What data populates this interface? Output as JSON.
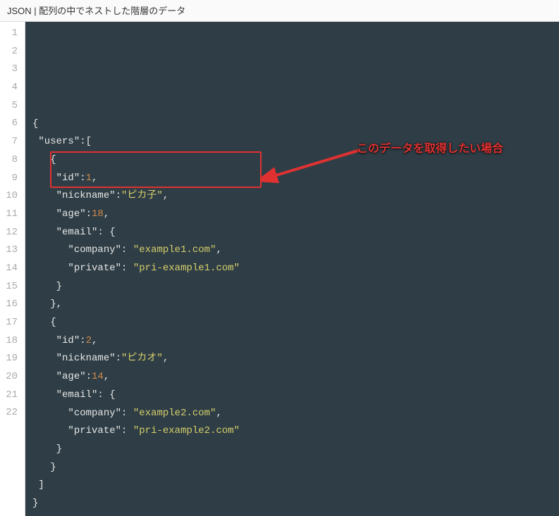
{
  "header": {
    "title": "JSON | 配列の中でネストした階層のデータ"
  },
  "annotation": {
    "text": "このデータを取得したい場合"
  },
  "code": {
    "lines": [
      [
        {
          "t": "{",
          "c": "punc"
        }
      ],
      [
        {
          "t": " ",
          "c": "punc"
        },
        {
          "t": "\"users\"",
          "c": "key"
        },
        {
          "t": ":[",
          "c": "punc"
        }
      ],
      [
        {
          "t": "   {",
          "c": "punc"
        }
      ],
      [
        {
          "t": "    ",
          "c": "punc"
        },
        {
          "t": "\"id\"",
          "c": "key"
        },
        {
          "t": ":",
          "c": "punc"
        },
        {
          "t": "1",
          "c": "num"
        },
        {
          "t": ",",
          "c": "punc"
        }
      ],
      [
        {
          "t": "    ",
          "c": "punc"
        },
        {
          "t": "\"nickname\"",
          "c": "key"
        },
        {
          "t": ":",
          "c": "punc"
        },
        {
          "t": "\"ピカ子\"",
          "c": "str"
        },
        {
          "t": ",",
          "c": "punc"
        }
      ],
      [
        {
          "t": "    ",
          "c": "punc"
        },
        {
          "t": "\"age\"",
          "c": "key"
        },
        {
          "t": ":",
          "c": "punc"
        },
        {
          "t": "18",
          "c": "num"
        },
        {
          "t": ",",
          "c": "punc"
        }
      ],
      [
        {
          "t": "    ",
          "c": "punc"
        },
        {
          "t": "\"email\"",
          "c": "key"
        },
        {
          "t": ": {",
          "c": "punc"
        }
      ],
      [
        {
          "t": "      ",
          "c": "punc"
        },
        {
          "t": "\"company\"",
          "c": "key"
        },
        {
          "t": ": ",
          "c": "punc"
        },
        {
          "t": "\"example1.com\"",
          "c": "str"
        },
        {
          "t": ",",
          "c": "punc"
        }
      ],
      [
        {
          "t": "      ",
          "c": "punc"
        },
        {
          "t": "\"private\"",
          "c": "key"
        },
        {
          "t": ": ",
          "c": "punc"
        },
        {
          "t": "\"pri-example1.com\"",
          "c": "str"
        }
      ],
      [
        {
          "t": "    }",
          "c": "punc"
        }
      ],
      [
        {
          "t": "   },",
          "c": "punc"
        }
      ],
      [
        {
          "t": "   {",
          "c": "punc"
        }
      ],
      [
        {
          "t": "    ",
          "c": "punc"
        },
        {
          "t": "\"id\"",
          "c": "key"
        },
        {
          "t": ":",
          "c": "punc"
        },
        {
          "t": "2",
          "c": "num"
        },
        {
          "t": ",",
          "c": "punc"
        }
      ],
      [
        {
          "t": "    ",
          "c": "punc"
        },
        {
          "t": "\"nickname\"",
          "c": "key"
        },
        {
          "t": ":",
          "c": "punc"
        },
        {
          "t": "\"ピカオ\"",
          "c": "str"
        },
        {
          "t": ",",
          "c": "punc"
        }
      ],
      [
        {
          "t": "    ",
          "c": "punc"
        },
        {
          "t": "\"age\"",
          "c": "key"
        },
        {
          "t": ":",
          "c": "punc"
        },
        {
          "t": "14",
          "c": "num"
        },
        {
          "t": ",",
          "c": "punc"
        }
      ],
      [
        {
          "t": "    ",
          "c": "punc"
        },
        {
          "t": "\"email\"",
          "c": "key"
        },
        {
          "t": ": {",
          "c": "punc"
        }
      ],
      [
        {
          "t": "      ",
          "c": "punc"
        },
        {
          "t": "\"company\"",
          "c": "key"
        },
        {
          "t": ": ",
          "c": "punc"
        },
        {
          "t": "\"example2.com\"",
          "c": "str"
        },
        {
          "t": ",",
          "c": "punc"
        }
      ],
      [
        {
          "t": "      ",
          "c": "punc"
        },
        {
          "t": "\"private\"",
          "c": "key"
        },
        {
          "t": ": ",
          "c": "punc"
        },
        {
          "t": "\"pri-example2.com\"",
          "c": "str"
        }
      ],
      [
        {
          "t": "    }",
          "c": "punc"
        }
      ],
      [
        {
          "t": "   }",
          "c": "punc"
        }
      ],
      [
        {
          "t": " ]",
          "c": "punc"
        }
      ],
      [
        {
          "t": "}",
          "c": "punc"
        }
      ]
    ]
  }
}
